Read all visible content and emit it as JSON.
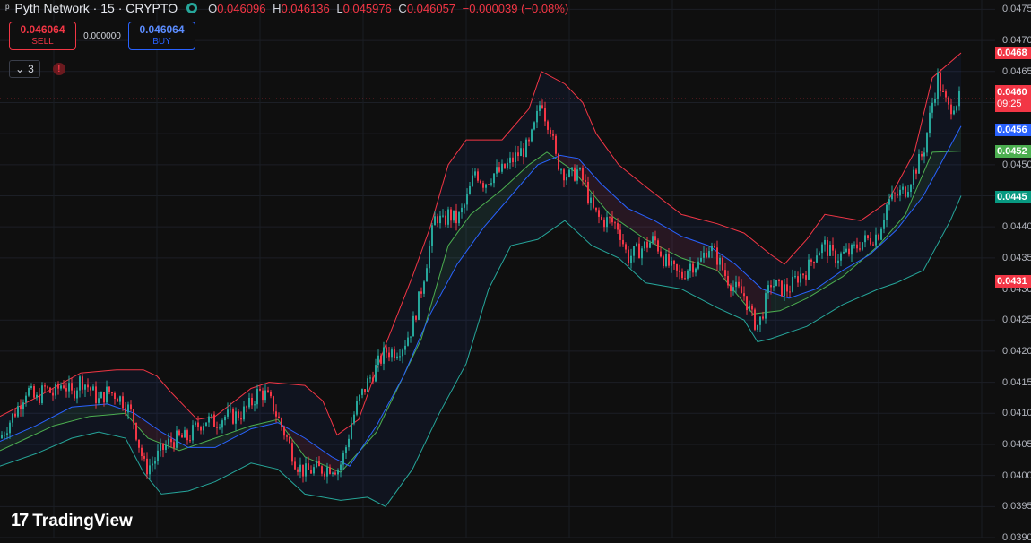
{
  "header": {
    "symbol_icon": "pyth-logo-icon",
    "title": "Pyth Network · 15 · CRYPTO",
    "status_icon": "market-status-icon",
    "ohlc": {
      "o_label": "O",
      "o": "0.046096",
      "h_label": "H",
      "h": "0.046136",
      "l_label": "L",
      "l": "0.045976",
      "c_label": "C",
      "c": "0.046057",
      "change": "−0.000039 (−0.08%)"
    }
  },
  "trade": {
    "sell_price": "0.046064",
    "sell_label": "SELL",
    "spread": "0.000000",
    "buy_price": "0.046064",
    "buy_label": "BUY"
  },
  "indicators": {
    "count": "3",
    "toggle_icon": "chevron-down-icon",
    "warning_icon": "warning-icon",
    "warning_text": "!"
  },
  "branding": {
    "logo_mark": "17",
    "logo_text": "TradingView"
  },
  "price_axis": {
    "ticks": [
      "0.0475",
      "0.0470",
      "0.0465",
      "0.0460",
      "0.0455",
      "0.0450",
      "0.0445",
      "0.0440",
      "0.0435",
      "0.0430",
      "0.0425",
      "0.0420",
      "0.0415",
      "0.0410",
      "0.0405",
      "0.0400",
      "0.0395",
      "0.0390"
    ],
    "labels": [
      {
        "text": "0.0468",
        "value": 0.0468,
        "color": "#f23645"
      },
      {
        "text": "0.0460",
        "value": 0.04606,
        "color": "#f23645",
        "sub": "09:25"
      },
      {
        "text": "0.0456",
        "value": 0.04556,
        "color": "#2962ff"
      },
      {
        "text": "0.0452",
        "value": 0.04522,
        "color": "#4caf50"
      },
      {
        "text": "0.0445",
        "value": 0.04448,
        "color": "#089981"
      },
      {
        "text": "0.0431",
        "value": 0.04312,
        "color": "#f23645"
      }
    ]
  },
  "colors": {
    "background": "#0f0f0f",
    "up": "#26a69a",
    "down": "#f23645",
    "basis": "#2962ff",
    "upper": "#f23645",
    "lower": "#26a69a",
    "cloud_green": "#4caf50",
    "current_line": "#f23645"
  },
  "chart_data": {
    "type": "candlestick",
    "ylim": [
      0.039,
      0.04765
    ],
    "current_price": 0.04606,
    "grid": true,
    "close_path": [
      [
        0,
        0.0406
      ],
      [
        10,
        0.04085
      ],
      [
        20,
        0.0411
      ],
      [
        30,
        0.0414
      ],
      [
        40,
        0.0412
      ],
      [
        50,
        0.0414
      ],
      [
        60,
        0.0413
      ],
      [
        70,
        0.0415
      ],
      [
        80,
        0.0413
      ],
      [
        90,
        0.04155
      ],
      [
        100,
        0.0414
      ],
      [
        110,
        0.0412
      ],
      [
        120,
        0.04135
      ],
      [
        130,
        0.0413
      ],
      [
        140,
        0.04115
      ],
      [
        148,
        0.04095
      ],
      [
        155,
        0.0405
      ],
      [
        162,
        0.0401
      ],
      [
        170,
        0.0402
      ],
      [
        180,
        0.0404
      ],
      [
        190,
        0.04055
      ],
      [
        200,
        0.0406
      ],
      [
        210,
        0.0406
      ],
      [
        220,
        0.0408
      ],
      [
        230,
        0.0409
      ],
      [
        240,
        0.04085
      ],
      [
        250,
        0.04095
      ],
      [
        260,
        0.04095
      ],
      [
        270,
        0.041
      ],
      [
        280,
        0.04115
      ],
      [
        288,
        0.04135
      ],
      [
        296,
        0.0413
      ],
      [
        305,
        0.0411
      ],
      [
        312,
        0.04085
      ],
      [
        320,
        0.0406
      ],
      [
        330,
        0.0402
      ],
      [
        340,
        0.04005
      ],
      [
        350,
        0.0401
      ],
      [
        360,
        0.0401
      ],
      [
        370,
        0.04015
      ],
      [
        378,
        0.0401
      ],
      [
        385,
        0.0404
      ],
      [
        392,
        0.04085
      ],
      [
        400,
        0.0412
      ],
      [
        410,
        0.0415
      ],
      [
        420,
        0.04175
      ],
      [
        430,
        0.042
      ],
      [
        440,
        0.042
      ],
      [
        450,
        0.0421
      ],
      [
        460,
        0.0424
      ],
      [
        470,
        0.043
      ],
      [
        478,
        0.0436
      ],
      [
        486,
        0.0442
      ],
      [
        494,
        0.04405
      ],
      [
        500,
        0.0442
      ],
      [
        510,
        0.0441
      ],
      [
        520,
        0.0444
      ],
      [
        530,
        0.0449
      ],
      [
        540,
        0.0447
      ],
      [
        550,
        0.04485
      ],
      [
        560,
        0.0449
      ],
      [
        570,
        0.04505
      ],
      [
        580,
        0.0452
      ],
      [
        590,
        0.0453
      ],
      [
        598,
        0.0457
      ],
      [
        604,
        0.0461
      ],
      [
        608,
        0.0458
      ],
      [
        614,
        0.0456
      ],
      [
        620,
        0.0451
      ],
      [
        628,
        0.0449
      ],
      [
        636,
        0.0448
      ],
      [
        644,
        0.0449
      ],
      [
        652,
        0.0447
      ],
      [
        660,
        0.0443
      ],
      [
        670,
        0.0441
      ],
      [
        680,
        0.0441
      ],
      [
        690,
        0.044
      ],
      [
        700,
        0.0435
      ],
      [
        710,
        0.0436
      ],
      [
        720,
        0.0437
      ],
      [
        730,
        0.0438
      ],
      [
        740,
        0.0435
      ],
      [
        750,
        0.0433
      ],
      [
        760,
        0.0432
      ],
      [
        770,
        0.0434
      ],
      [
        780,
        0.0434
      ],
      [
        790,
        0.0437
      ],
      [
        800,
        0.0435
      ],
      [
        810,
        0.0432
      ],
      [
        820,
        0.043
      ],
      [
        830,
        0.0429
      ],
      [
        840,
        0.0425
      ],
      [
        846,
        0.0424
      ],
      [
        852,
        0.0427
      ],
      [
        860,
        0.0431
      ],
      [
        870,
        0.043
      ],
      [
        880,
        0.043
      ],
      [
        890,
        0.0432
      ],
      [
        900,
        0.0433
      ],
      [
        910,
        0.0436
      ],
      [
        920,
        0.0437
      ],
      [
        930,
        0.0435
      ],
      [
        940,
        0.04355
      ],
      [
        950,
        0.0436
      ],
      [
        960,
        0.04375
      ],
      [
        970,
        0.0438
      ],
      [
        980,
        0.0439
      ],
      [
        990,
        0.0444
      ],
      [
        1000,
        0.0445
      ],
      [
        1010,
        0.0446
      ],
      [
        1020,
        0.0449
      ],
      [
        1030,
        0.0452
      ],
      [
        1040,
        0.046
      ],
      [
        1046,
        0.0464
      ],
      [
        1052,
        0.0461
      ],
      [
        1058,
        0.0459
      ],
      [
        1064,
        0.046
      ],
      [
        1072,
        0.04606
      ]
    ],
    "upper_band": [
      [
        0,
        0.04095
      ],
      [
        40,
        0.04125
      ],
      [
        90,
        0.04165
      ],
      [
        130,
        0.0417
      ],
      [
        160,
        0.0417
      ],
      [
        175,
        0.0416
      ],
      [
        190,
        0.04135
      ],
      [
        210,
        0.04105
      ],
      [
        220,
        0.0409
      ],
      [
        240,
        0.04095
      ],
      [
        280,
        0.0414
      ],
      [
        300,
        0.0415
      ],
      [
        340,
        0.04145
      ],
      [
        360,
        0.0412
      ],
      [
        376,
        0.04065
      ],
      [
        400,
        0.0409
      ],
      [
        430,
        0.0421
      ],
      [
        460,
        0.0432
      ],
      [
        480,
        0.044
      ],
      [
        500,
        0.045
      ],
      [
        520,
        0.0454
      ],
      [
        560,
        0.0454
      ],
      [
        590,
        0.0459
      ],
      [
        604,
        0.0465
      ],
      [
        630,
        0.0463
      ],
      [
        650,
        0.046
      ],
      [
        665,
        0.0455
      ],
      [
        690,
        0.045
      ],
      [
        720,
        0.04465
      ],
      [
        760,
        0.0442
      ],
      [
        800,
        0.04405
      ],
      [
        830,
        0.0439
      ],
      [
        860,
        0.04355
      ],
      [
        875,
        0.0434
      ],
      [
        900,
        0.0438
      ],
      [
        920,
        0.0442
      ],
      [
        960,
        0.0441
      ],
      [
        990,
        0.0444
      ],
      [
        1020,
        0.0452
      ],
      [
        1040,
        0.0464
      ],
      [
        1072,
        0.0468
      ]
    ],
    "lower_band": [
      [
        0,
        0.04015
      ],
      [
        40,
        0.04035
      ],
      [
        80,
        0.0406
      ],
      [
        110,
        0.0407
      ],
      [
        140,
        0.0406
      ],
      [
        160,
        0.04005
      ],
      [
        180,
        0.0397
      ],
      [
        210,
        0.03975
      ],
      [
        240,
        0.0399
      ],
      [
        280,
        0.0402
      ],
      [
        310,
        0.0401
      ],
      [
        340,
        0.0397
      ],
      [
        360,
        0.03965
      ],
      [
        380,
        0.0396
      ],
      [
        410,
        0.03965
      ],
      [
        430,
        0.0395
      ],
      [
        460,
        0.0401
      ],
      [
        490,
        0.041
      ],
      [
        520,
        0.0418
      ],
      [
        545,
        0.043
      ],
      [
        570,
        0.0437
      ],
      [
        600,
        0.0438
      ],
      [
        630,
        0.0441
      ],
      [
        660,
        0.0437
      ],
      [
        690,
        0.0435
      ],
      [
        720,
        0.0431
      ],
      [
        760,
        0.043
      ],
      [
        800,
        0.0427
      ],
      [
        830,
        0.0425
      ],
      [
        845,
        0.04215
      ],
      [
        860,
        0.0422
      ],
      [
        900,
        0.0424
      ],
      [
        940,
        0.04275
      ],
      [
        980,
        0.043
      ],
      [
        1000,
        0.0431
      ],
      [
        1030,
        0.0433
      ],
      [
        1060,
        0.0441
      ],
      [
        1072,
        0.0445
      ]
    ],
    "basis": [
      [
        0,
        0.04055
      ],
      [
        40,
        0.0408
      ],
      [
        80,
        0.0411
      ],
      [
        120,
        0.04115
      ],
      [
        150,
        0.041
      ],
      [
        180,
        0.0407
      ],
      [
        210,
        0.04045
      ],
      [
        240,
        0.04045
      ],
      [
        280,
        0.04075
      ],
      [
        310,
        0.04085
      ],
      [
        340,
        0.0406
      ],
      [
        370,
        0.0403
      ],
      [
        390,
        0.04015
      ],
      [
        420,
        0.0408
      ],
      [
        450,
        0.0416
      ],
      [
        480,
        0.0426
      ],
      [
        510,
        0.0434
      ],
      [
        540,
        0.044
      ],
      [
        570,
        0.0445
      ],
      [
        600,
        0.045
      ],
      [
        625,
        0.04515
      ],
      [
        645,
        0.0451
      ],
      [
        670,
        0.0447
      ],
      [
        700,
        0.0443
      ],
      [
        730,
        0.0441
      ],
      [
        760,
        0.04385
      ],
      [
        790,
        0.0437
      ],
      [
        820,
        0.0434
      ],
      [
        850,
        0.043
      ],
      [
        880,
        0.04285
      ],
      [
        910,
        0.043
      ],
      [
        940,
        0.0433
      ],
      [
        970,
        0.04355
      ],
      [
        1000,
        0.04395
      ],
      [
        1030,
        0.0445
      ],
      [
        1072,
        0.04562
      ]
    ],
    "fast_line": [
      [
        0,
        0.0404
      ],
      [
        30,
        0.0406
      ],
      [
        60,
        0.0408
      ],
      [
        100,
        0.04095
      ],
      [
        140,
        0.041
      ],
      [
        165,
        0.0406
      ],
      [
        200,
        0.0404
      ],
      [
        240,
        0.0406
      ],
      [
        280,
        0.0408
      ],
      [
        310,
        0.0409
      ],
      [
        340,
        0.0403
      ],
      [
        380,
        0.04005
      ],
      [
        420,
        0.0407
      ],
      [
        470,
        0.0422
      ],
      [
        500,
        0.0437
      ],
      [
        525,
        0.0442
      ],
      [
        560,
        0.0446
      ],
      [
        590,
        0.045
      ],
      [
        610,
        0.0452
      ],
      [
        640,
        0.0449
      ],
      [
        680,
        0.0442
      ],
      [
        720,
        0.0438
      ],
      [
        760,
        0.0435
      ],
      [
        800,
        0.0433
      ],
      [
        840,
        0.0426
      ],
      [
        870,
        0.04265
      ],
      [
        900,
        0.04285
      ],
      [
        940,
        0.0432
      ],
      [
        980,
        0.0437
      ],
      [
        1010,
        0.0442
      ],
      [
        1040,
        0.0452
      ],
      [
        1072,
        0.04522
      ]
    ]
  }
}
